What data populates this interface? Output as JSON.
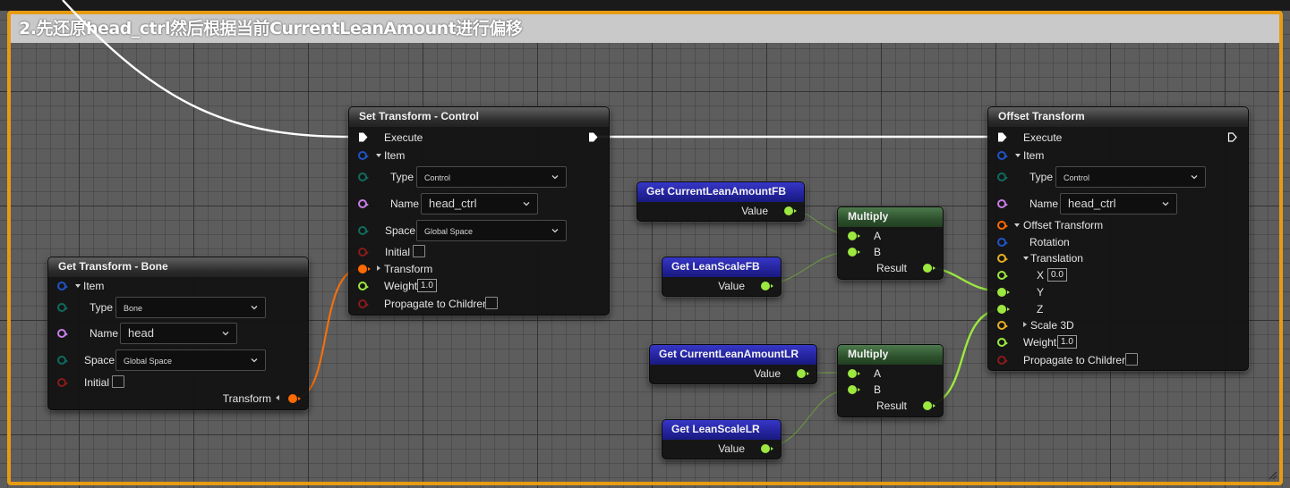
{
  "comment": {
    "title": "2.先还原head_ctrl然后根据当前CurrentLeanAmount进行偏移"
  },
  "colors": {
    "comment_border": "#e69b12",
    "exec_wire": "#ffffff",
    "transform_pin": "#ff6a00",
    "float_pin": "#9ce840",
    "name_pin": "#c77de8",
    "enum_pin": "#0f6b5e",
    "bool_pin": "#8a1a1a",
    "struct_pin": "#1f54c6",
    "vector_pin": "#e8b020"
  },
  "get_transform_bone": {
    "title": "Get Transform - Bone",
    "item_label": "Item",
    "type_label": "Type",
    "type_value": "Bone",
    "name_label": "Name",
    "name_value": "head",
    "space_label": "Space",
    "space_value": "Global Space",
    "initial_label": "Initial",
    "transform_label": "Transform"
  },
  "set_transform_control": {
    "title": "Set Transform - Control",
    "execute_label": "Execute",
    "item_label": "Item",
    "type_label": "Type",
    "type_value": "Control",
    "name_label": "Name",
    "name_value": "head_ctrl",
    "space_label": "Space",
    "space_value": "Global Space",
    "initial_label": "Initial",
    "transform_label": "Transform",
    "weight_label": "Weight",
    "weight_value": "1.0",
    "propagate_label": "Propagate to Children"
  },
  "get_current_lean_fb": {
    "title": "Get CurrentLeanAmountFB",
    "value_label": "Value"
  },
  "get_lean_scale_fb": {
    "title": "Get LeanScaleFB",
    "value_label": "Value"
  },
  "get_current_lean_lr": {
    "title": "Get CurrentLeanAmountLR",
    "value_label": "Value"
  },
  "get_lean_scale_lr": {
    "title": "Get LeanScaleLR",
    "value_label": "Value"
  },
  "multiply_1": {
    "title": "Multiply",
    "a_label": "A",
    "b_label": "B",
    "result_label": "Result"
  },
  "multiply_2": {
    "title": "Multiply",
    "a_label": "A",
    "b_label": "B",
    "result_label": "Result"
  },
  "offset_transform": {
    "title": "Offset Transform",
    "execute_label": "Execute",
    "item_label": "Item",
    "type_label": "Type",
    "type_value": "Control",
    "name_label": "Name",
    "name_value": "head_ctrl",
    "offset_label": "Offset Transform",
    "rotation_label": "Rotation",
    "translation_label": "Translation",
    "x_label": "X",
    "x_value": "0.0",
    "y_label": "Y",
    "z_label": "Z",
    "scale_label": "Scale 3D",
    "weight_label": "Weight",
    "weight_value": "1.0",
    "propagate_label": "Propagate to Children"
  }
}
